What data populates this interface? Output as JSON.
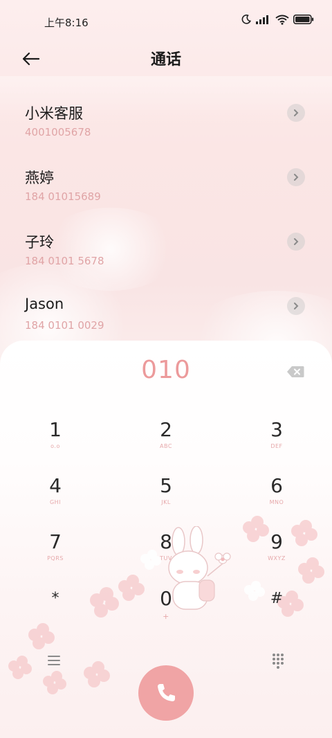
{
  "status_bar": {
    "time": "上午8:16"
  },
  "header": {
    "title": "通话"
  },
  "contacts": [
    {
      "name": "小米客服",
      "number": "4001005678"
    },
    {
      "name": "燕婷",
      "number": "184 01015689"
    },
    {
      "name": "子玲",
      "number": "184 0101 5678"
    },
    {
      "name": "Jason",
      "number": "184 0101 0029"
    }
  ],
  "dialer": {
    "input": "010",
    "keys": [
      {
        "digit": "1",
        "letters": "o.o"
      },
      {
        "digit": "2",
        "letters": "ABC"
      },
      {
        "digit": "3",
        "letters": "DEF"
      },
      {
        "digit": "4",
        "letters": "GHI"
      },
      {
        "digit": "5",
        "letters": "JKL"
      },
      {
        "digit": "6",
        "letters": "MNO"
      },
      {
        "digit": "7",
        "letters": "PQRS"
      },
      {
        "digit": "8",
        "letters": "TUV"
      },
      {
        "digit": "9",
        "letters": "WXYZ"
      },
      {
        "digit": "*",
        "letters": ""
      },
      {
        "digit": "0",
        "letters": "+"
      },
      {
        "digit": "#",
        "letters": ""
      }
    ]
  },
  "colors": {
    "accent": "#ec9a9b",
    "call_button": "#f0a4a5",
    "number_text": "#e0a4a6"
  },
  "icons": {
    "back": "back-arrow-icon",
    "backspace": "backspace-icon",
    "menu": "menu-icon",
    "keypad": "keypad-icon",
    "call": "phone-icon"
  }
}
